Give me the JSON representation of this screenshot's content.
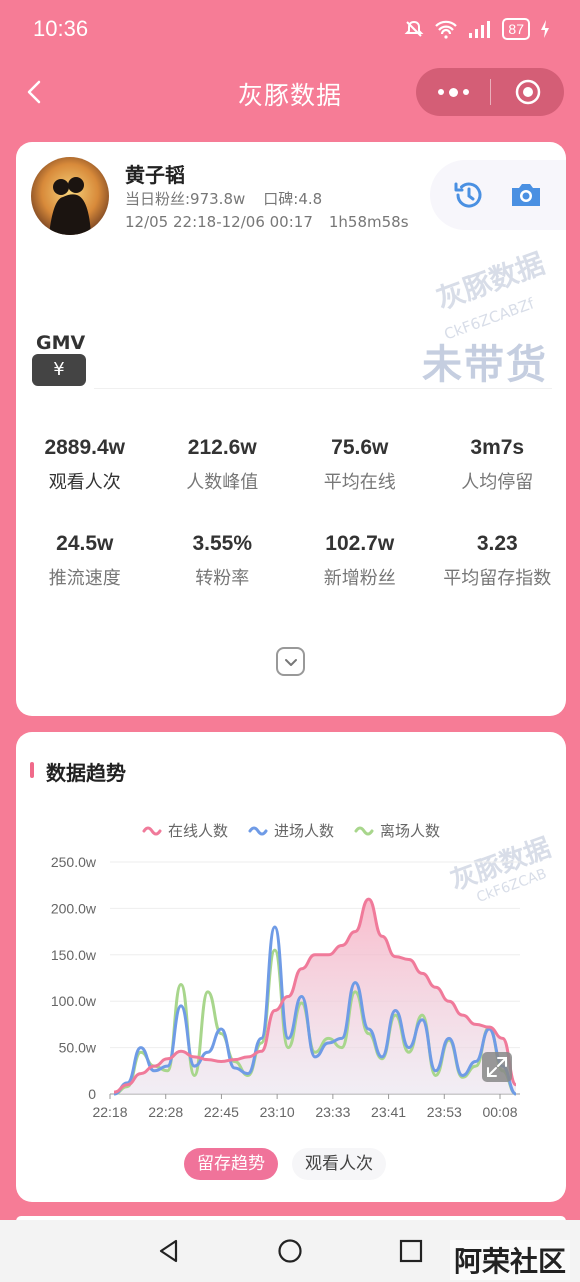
{
  "status_bar": {
    "time": "10:36",
    "battery": "87"
  },
  "nav": {
    "title": "灰豚数据"
  },
  "anchor": {
    "name": "黄子韬",
    "fans": "当日粉丝:973.8w",
    "reputation": "口碑:4.8",
    "time_range": "12/05 22:18-12/06 00:17",
    "duration": "1h58m58s"
  },
  "watermark": {
    "brand": "灰豚数据",
    "code": "CkF6ZCABZf",
    "code2": "CkF6ZCAB",
    "no_sale": "未带货"
  },
  "gmv": {
    "label": "GMV",
    "symbol": "¥"
  },
  "metrics_row1": [
    {
      "value": "2889.4w",
      "label": "观看人次"
    },
    {
      "value": "212.6w",
      "label": "人数峰值"
    },
    {
      "value": "75.6w",
      "label": "平均在线"
    },
    {
      "value": "3m7s",
      "label": "人均停留"
    }
  ],
  "metrics_row2": [
    {
      "value": "24.5w",
      "label": "推流速度"
    },
    {
      "value": "3.55%",
      "label": "转粉率"
    },
    {
      "value": "102.7w",
      "label": "新增粉丝"
    },
    {
      "value": "3.23",
      "label": "平均留存指数"
    }
  ],
  "trend": {
    "title": "数据趋势"
  },
  "tabs": {
    "active": "留存趋势",
    "inactive": "观看人次"
  },
  "colors": {
    "online": "#f07a9a",
    "enter": "#6f9be6",
    "leave": "#a8d68c",
    "accent": "#f67c96"
  },
  "footer": {
    "forum": "阿荣社区"
  },
  "chart_data": {
    "type": "line",
    "legend": [
      "在线人数",
      "进场人数",
      "离场人数"
    ],
    "y_ticks": [
      "250.0w",
      "200.0w",
      "150.0w",
      "100.0w",
      "50.0w",
      "0"
    ],
    "ylim": [
      0,
      250
    ],
    "x_ticks": [
      "22:18",
      "22:28",
      "22:45",
      "23:10",
      "23:33",
      "23:41",
      "23:53",
      "00:08"
    ],
    "series": [
      {
        "name": "在线人数",
        "values": [
          2,
          10,
          22,
          30,
          38,
          46,
          40,
          37,
          35,
          37,
          40,
          46,
          90,
          105,
          135,
          150,
          150,
          160,
          175,
          210,
          170,
          148,
          145,
          130,
          115,
          100,
          85,
          75,
          72,
          60,
          10
        ]
      },
      {
        "name": "进场人数",
        "values": [
          0,
          12,
          50,
          25,
          30,
          95,
          30,
          45,
          70,
          28,
          22,
          60,
          180,
          60,
          105,
          40,
          55,
          60,
          120,
          70,
          40,
          90,
          50,
          80,
          25,
          60,
          20,
          35,
          70,
          30,
          0
        ]
      },
      {
        "name": "离场人数",
        "values": [
          0,
          8,
          45,
          30,
          25,
          118,
          20,
          110,
          65,
          35,
          20,
          55,
          155,
          50,
          98,
          45,
          60,
          50,
          110,
          65,
          38,
          85,
          45,
          85,
          20,
          58,
          18,
          30,
          72,
          25,
          0
        ]
      }
    ]
  }
}
